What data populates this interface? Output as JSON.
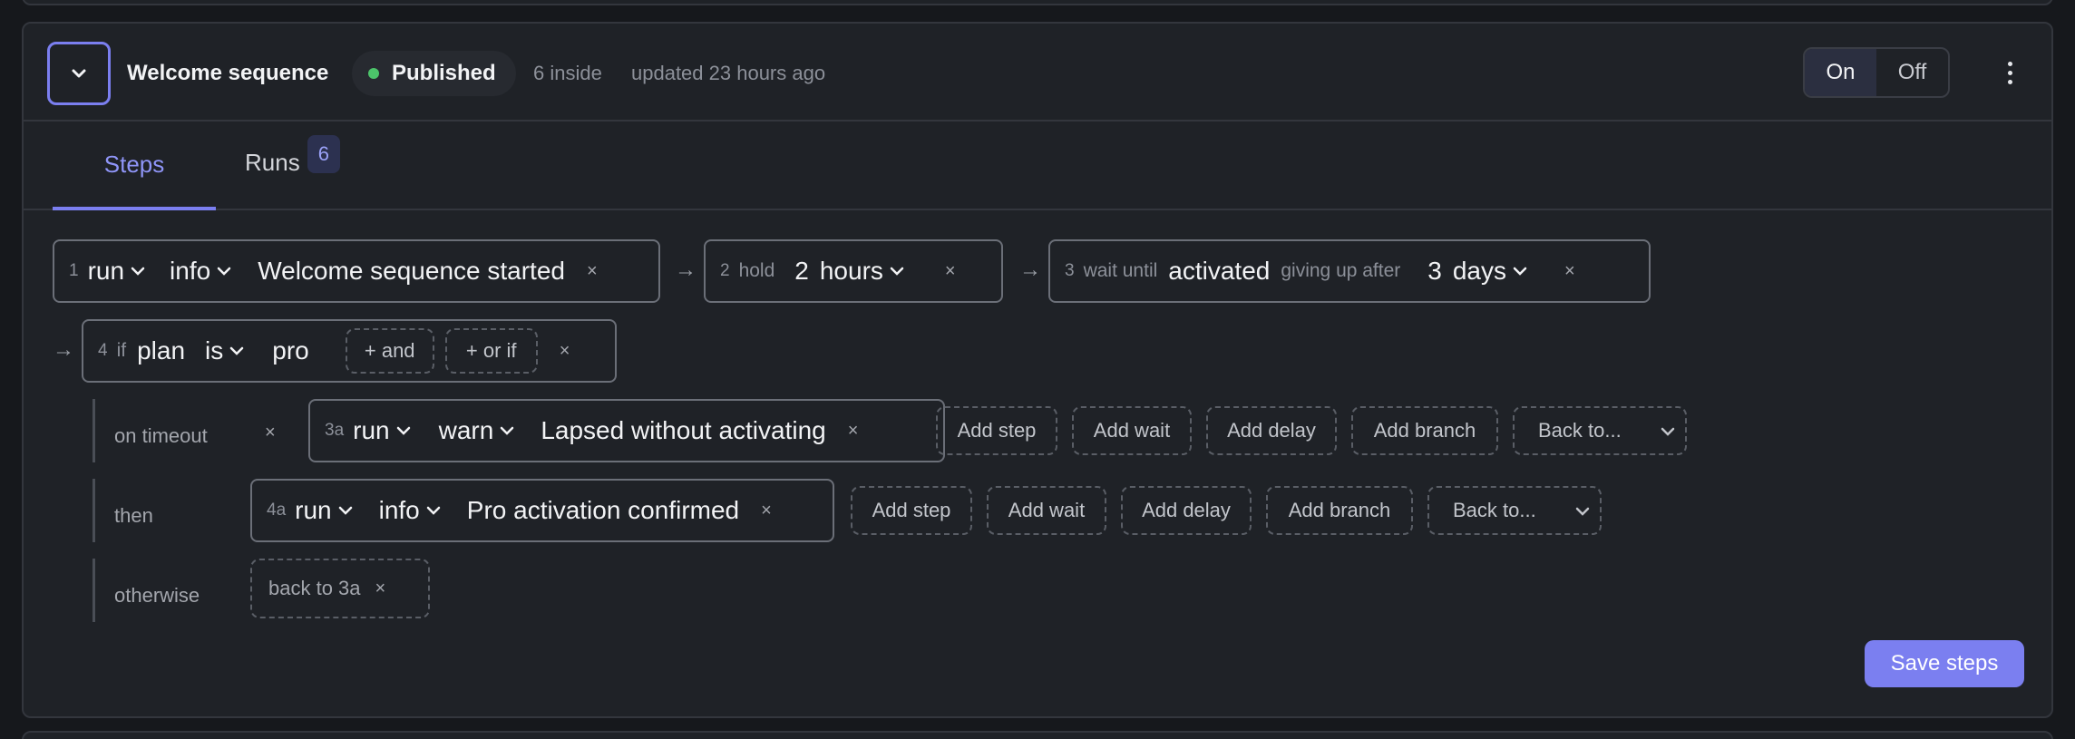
{
  "header": {
    "title": "Welcome sequence",
    "status": "Published",
    "status_color": "#4cc46a",
    "count_text": "6 inside",
    "updated_text": "updated 23 hours ago",
    "toggle_on": "On",
    "toggle_off": "Off",
    "toggle_selected": "On"
  },
  "tabs": {
    "steps": "Steps",
    "runs": "Runs",
    "runs_count": "6",
    "active": "Steps"
  },
  "steps": {
    "s1": {
      "num": "1",
      "action": "run",
      "level": "info",
      "message": "Welcome sequence started",
      "remove": "×"
    },
    "s2": {
      "num": "2",
      "kw": "hold",
      "amount": "2",
      "unit": "hours",
      "remove": "×"
    },
    "s3": {
      "num": "3",
      "kw1": "wait until",
      "event": "activated",
      "kw2": "giving up after",
      "amount": "3",
      "unit": "days",
      "remove": "×"
    },
    "s4": {
      "num": "4",
      "kw": "if",
      "field": "plan",
      "op": "is",
      "value": "pro",
      "and": "+ and",
      "or_if": "+ or if",
      "remove": "×"
    },
    "arrow": "→"
  },
  "branches": {
    "timeout": {
      "label": "on timeout",
      "remove": "×",
      "step": {
        "num": "3a",
        "action": "run",
        "level": "warn",
        "message": "Lapsed without activating",
        "remove": "×"
      }
    },
    "then": {
      "label": "then",
      "step": {
        "num": "4a",
        "action": "run",
        "level": "info",
        "message": "Pro activation confirmed",
        "remove": "×"
      }
    },
    "otherwise": {
      "label": "otherwise",
      "back_chip": "back to 3a",
      "remove": "×"
    }
  },
  "actions": {
    "add_step": "Add step",
    "add_wait": "Add wait",
    "add_delay": "Add delay",
    "add_branch": "Add branch",
    "back_to": "Back to..."
  },
  "footer": {
    "save": "Save steps"
  },
  "colors": {
    "accent": "#7b7ff0",
    "background": "#1f2227",
    "published": "#4cc46a"
  }
}
